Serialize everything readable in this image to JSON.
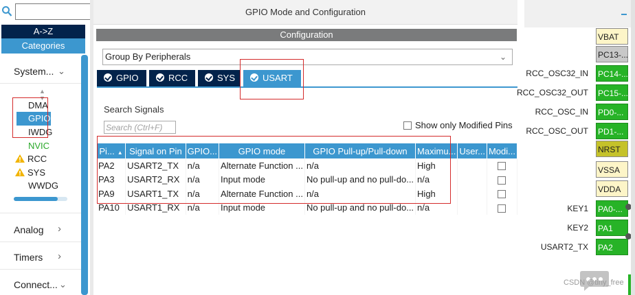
{
  "left_panel": {
    "search": {
      "placeholder": "",
      "value": ""
    },
    "az_label": "A->Z",
    "categories_label": "Categories",
    "system_label": "System...",
    "system_items": [
      {
        "label": "DMA",
        "state": "normal"
      },
      {
        "label": "GPIO",
        "state": "selected"
      },
      {
        "label": "IWDG",
        "state": "normal"
      },
      {
        "label": "NVIC",
        "state": "green"
      },
      {
        "label": "RCC",
        "state": "warning"
      },
      {
        "label": "SYS",
        "state": "warning"
      },
      {
        "label": "WWDG",
        "state": "normal"
      }
    ],
    "progress": 0.82,
    "analog_label": "Analog",
    "timers_label": "Timers",
    "connect_label": "Connect..."
  },
  "center_panel": {
    "title": "GPIO Mode and Configuration",
    "config_label": "Configuration",
    "group_select": "Group By Peripherals",
    "tabs": [
      {
        "label": "GPIO",
        "active": false
      },
      {
        "label": "RCC",
        "active": false
      },
      {
        "label": "SYS",
        "active": false
      },
      {
        "label": "USART",
        "active": true
      }
    ],
    "search_signals_label": "Search Signals",
    "search_placeholder": "Search (Ctrl+F)",
    "show_modified_label": "Show only Modified Pins",
    "table": {
      "headers": [
        "Pi...",
        "Signal on Pin",
        "GPIO...",
        "GPIO mode",
        "GPIO Pull-up/Pull-down",
        "Maximu...",
        "User...",
        "Modi..."
      ],
      "rows": [
        [
          "PA2",
          "USART2_TX",
          "n/a",
          "Alternate Function ...",
          "n/a",
          "High",
          "",
          ""
        ],
        [
          "PA3",
          "USART2_RX",
          "n/a",
          "Input mode",
          "No pull-up and no pull-do...",
          "n/a",
          "",
          ""
        ],
        [
          "PA9",
          "USART1_TX",
          "n/a",
          "Alternate Function ...",
          "n/a",
          "High",
          "",
          ""
        ],
        [
          "PA10",
          "USART1_RX",
          "n/a",
          "Input mode",
          "No pull-up and no pull-do...",
          "n/a",
          "",
          ""
        ]
      ]
    }
  },
  "right_panel": {
    "pins": [
      {
        "signal": "",
        "pin": "VBAT",
        "style": "cream"
      },
      {
        "signal": "",
        "pin": "PC13-...",
        "style": "gray"
      },
      {
        "signal": "RCC_OSC32_IN",
        "pin": "PC14-...",
        "style": "green"
      },
      {
        "signal": "RCC_OSC32_OUT",
        "pin": "PC15-...",
        "style": "green"
      },
      {
        "signal": "RCC_OSC_IN",
        "pin": "PD0-...",
        "style": "green"
      },
      {
        "signal": "RCC_OSC_OUT",
        "pin": "PD1-...",
        "style": "green"
      },
      {
        "signal": "",
        "pin": "NRST",
        "style": "olive"
      },
      {
        "signal": "",
        "pin": "VSSA",
        "style": "cream"
      },
      {
        "signal": "",
        "pin": "VDDA",
        "style": "cream"
      },
      {
        "signal": "KEY1",
        "pin": "PA0-...",
        "style": "green"
      },
      {
        "signal": "KEY2",
        "pin": "PA1",
        "style": "green"
      },
      {
        "signal": "USART2_TX",
        "pin": "PA2",
        "style": "green"
      }
    ],
    "watermark": "CSDN @tiny_free"
  },
  "colors": {
    "navy": "#03234b",
    "accent_blue": "#3c97cf",
    "pin_green": "#27b327",
    "highlight_red": "#d42a2a"
  }
}
